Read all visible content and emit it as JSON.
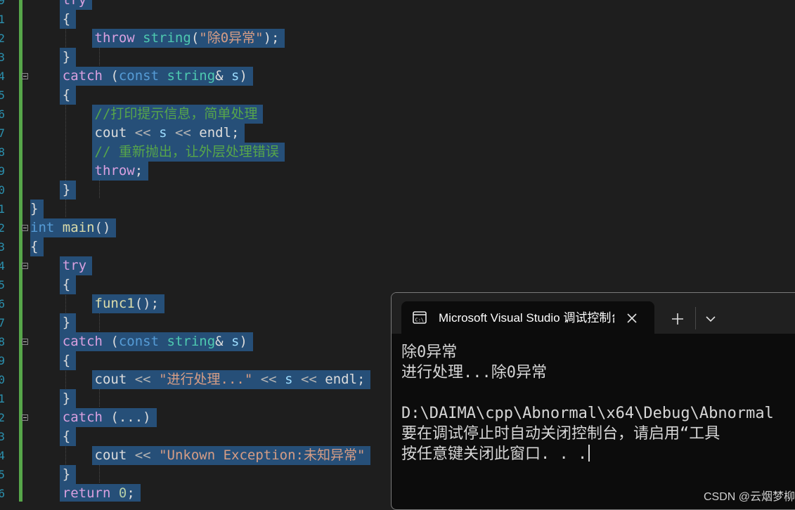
{
  "editor": {
    "line_numbers": [
      "9",
      "1",
      "2",
      "3",
      "4",
      "5",
      "6",
      "7",
      "8",
      "9",
      "0",
      "1",
      "2",
      "3",
      "4",
      "5",
      "6",
      "7",
      "8",
      "9",
      "0",
      "1",
      "2",
      "3",
      "4",
      "5",
      "6"
    ],
    "lines": [
      [
        {
          "t": "    "
        },
        {
          "t": "try",
          "c": "ctl"
        }
      ],
      [
        {
          "t": "    {"
        }
      ],
      [
        {
          "t": "        "
        },
        {
          "t": "throw",
          "c": "ctl"
        },
        {
          "t": " "
        },
        {
          "t": "string",
          "c": "ty"
        },
        {
          "t": "("
        },
        {
          "t": "\"除0异常\"",
          "c": "str"
        },
        {
          "t": ");"
        }
      ],
      [
        {
          "t": "    }"
        }
      ],
      [
        {
          "t": "    "
        },
        {
          "t": "catch",
          "c": "ctl"
        },
        {
          "t": " ("
        },
        {
          "t": "const",
          "c": "kw"
        },
        {
          "t": " "
        },
        {
          "t": "string",
          "c": "ty"
        },
        {
          "t": "& "
        },
        {
          "t": "s",
          "c": "var"
        },
        {
          "t": ")"
        }
      ],
      [
        {
          "t": "    {"
        }
      ],
      [
        {
          "t": "        "
        },
        {
          "t": "//打印提示信息，简单处理",
          "c": "cm"
        }
      ],
      [
        {
          "t": "        cout "
        },
        {
          "t": "<<",
          "c": "op"
        },
        {
          "t": " "
        },
        {
          "t": "s",
          "c": "var"
        },
        {
          "t": " "
        },
        {
          "t": "<<",
          "c": "op"
        },
        {
          "t": " endl;"
        }
      ],
      [
        {
          "t": "        "
        },
        {
          "t": "// 重新抛出，让外层处理错误",
          "c": "cm"
        }
      ],
      [
        {
          "t": "        "
        },
        {
          "t": "throw",
          "c": "ctl"
        },
        {
          "t": ";"
        }
      ],
      [
        {
          "t": "    }"
        }
      ],
      [
        {
          "t": "}"
        }
      ],
      [
        {
          "t": "int",
          "c": "kw"
        },
        {
          "t": " "
        },
        {
          "t": "main",
          "c": "fn"
        },
        {
          "t": "()"
        }
      ],
      [
        {
          "t": "{"
        }
      ],
      [
        {
          "t": "    "
        },
        {
          "t": "try",
          "c": "ctl"
        }
      ],
      [
        {
          "t": "    {"
        }
      ],
      [
        {
          "t": "        "
        },
        {
          "t": "func1",
          "c": "fn"
        },
        {
          "t": "();"
        }
      ],
      [
        {
          "t": "    }"
        }
      ],
      [
        {
          "t": "    "
        },
        {
          "t": "catch",
          "c": "ctl"
        },
        {
          "t": " ("
        },
        {
          "t": "const",
          "c": "kw"
        },
        {
          "t": " "
        },
        {
          "t": "string",
          "c": "ty"
        },
        {
          "t": "& "
        },
        {
          "t": "s",
          "c": "var"
        },
        {
          "t": ")"
        }
      ],
      [
        {
          "t": "    {"
        }
      ],
      [
        {
          "t": "        cout "
        },
        {
          "t": "<<",
          "c": "op"
        },
        {
          "t": " "
        },
        {
          "t": "\"进行处理...\"",
          "c": "str"
        },
        {
          "t": " "
        },
        {
          "t": "<<",
          "c": "op"
        },
        {
          "t": " "
        },
        {
          "t": "s",
          "c": "var"
        },
        {
          "t": " "
        },
        {
          "t": "<<",
          "c": "op"
        },
        {
          "t": " endl;"
        }
      ],
      [
        {
          "t": "    }"
        }
      ],
      [
        {
          "t": "    "
        },
        {
          "t": "catch",
          "c": "ctl"
        },
        {
          "t": " (...)"
        }
      ],
      [
        {
          "t": "    {"
        }
      ],
      [
        {
          "t": "        cout "
        },
        {
          "t": "<<",
          "c": "op"
        },
        {
          "t": " "
        },
        {
          "t": "\"Unkown Exception:未知异常\"",
          "c": "str"
        }
      ],
      [
        {
          "t": "    }"
        }
      ],
      [
        {
          "t": "    "
        },
        {
          "t": "return",
          "c": "ctl"
        },
        {
          "t": " "
        },
        {
          "t": "0",
          "c": "num"
        },
        {
          "t": ";"
        }
      ]
    ]
  },
  "terminal": {
    "tab_title": "Microsoft Visual Studio 调试控制台",
    "output_lines": [
      "除0异常",
      "进行处理...除0异常",
      "",
      "D:\\DAIMA\\cpp\\Abnormal\\x64\\Debug\\Abnormal",
      "要在调试停止时自动关闭控制台，请启用“工具",
      "按任意键关闭此窗口. . ."
    ]
  },
  "watermark": "CSDN @云烟梦柳"
}
